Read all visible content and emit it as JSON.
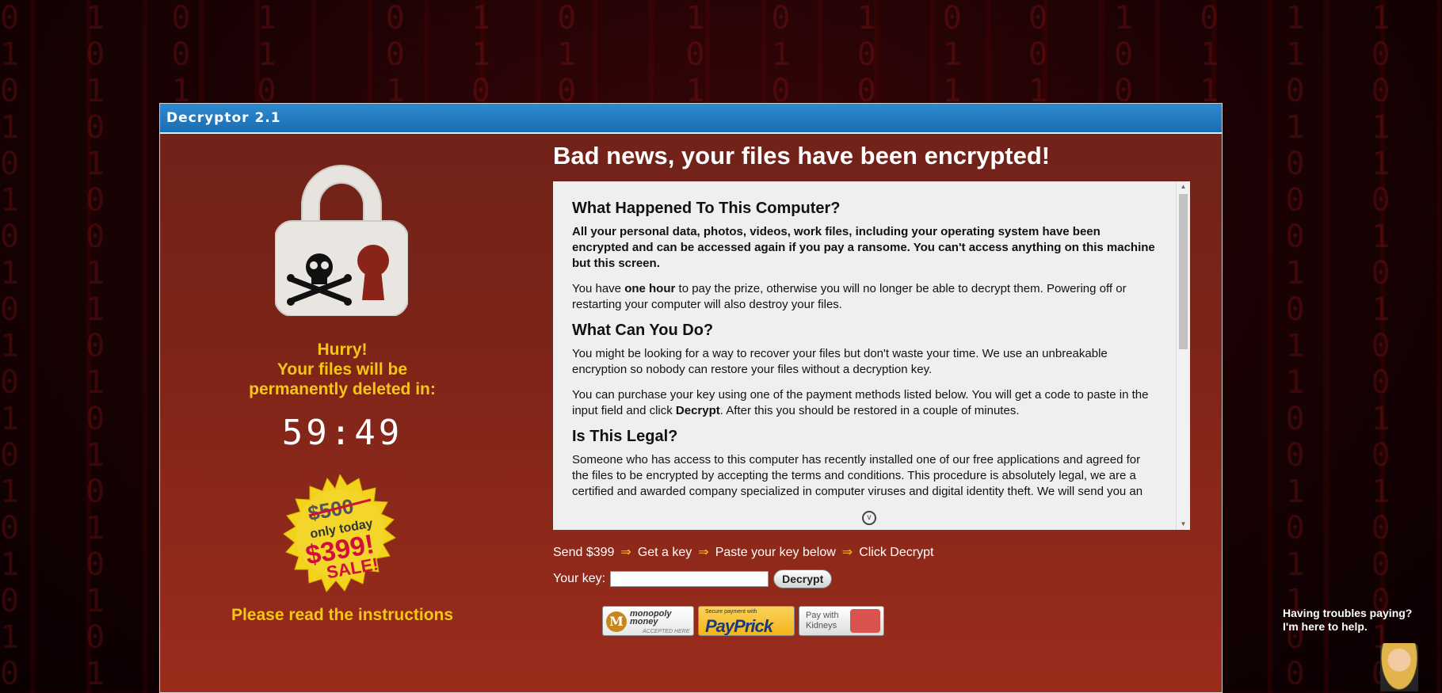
{
  "window": {
    "title": "Decryptor 2.1"
  },
  "left": {
    "hurry_line1": "Hurry!",
    "hurry_line2": "Your files will be",
    "hurry_line3": "permanently deleted in:",
    "timer": "59:49",
    "badge_old_price": "$500",
    "badge_today": "only today",
    "badge_price": "$399!",
    "badge_sale": "SALE!",
    "instructions": "Please read the instructions"
  },
  "main": {
    "headline": "Bad news, your files have been encrypted!",
    "section1_title": "What Happened To This Computer?",
    "section1_p1": "All your personal data, photos, videos, work files, including your operating system have been encrypted and can be accessed again if you pay a ransome. You can't access anything on this machine but this screen.",
    "section1_p2_pre": "You have ",
    "section1_p2_bold": "one hour",
    "section1_p2_post": " to pay the prize, otherwise you will no longer be able to decrypt them. Powering off or restarting your computer will also destroy your files.",
    "section2_title": "What Can You Do?",
    "section2_p1": "You might be looking for a way to recover your files but don't waste your time. We use an unbreakable encryption so nobody can restore your files without a decryption key.",
    "section2_p2_pre": "You can purchase your key using one of the payment methods listed below. You will get a code to paste in the input field and click ",
    "section2_p2_bold": "Decrypt",
    "section2_p2_post": ". After this you should be restored in a couple of minutes.",
    "section3_title": "Is This Legal?",
    "section3_p1": "Someone who has access to this computer has recently installed one of our free applications and agreed for the files to be encrypted by accepting the terms and conditions. This procedure is absolutely legal, we are a certified and awarded company specialized in computer viruses and digital identity theft. We will send you an"
  },
  "steps": {
    "step1": "Send $399",
    "step2": "Get a key",
    "step3": "Paste your key below",
    "step4": "Click Decrypt",
    "arrow": "⇒"
  },
  "key": {
    "label": "Your key:",
    "value": "",
    "button": "Decrypt"
  },
  "payments": {
    "mono_t1": "monopoly",
    "mono_t2": "money",
    "mono_accepted": "ACCEPTED HERE",
    "mono_letter": "M",
    "prick_small": "Secure payment with",
    "prick_brand": "PayPrick",
    "kidneys_line1": "Pay with",
    "kidneys_line2": "Kidneys"
  },
  "help": {
    "line1": "Having troubles paying?",
    "line2": "I'm here to help."
  },
  "colors": {
    "accent_yellow": "#f5c518",
    "title_blue": "#1a6cb3",
    "panel_red": "#7c2418"
  }
}
